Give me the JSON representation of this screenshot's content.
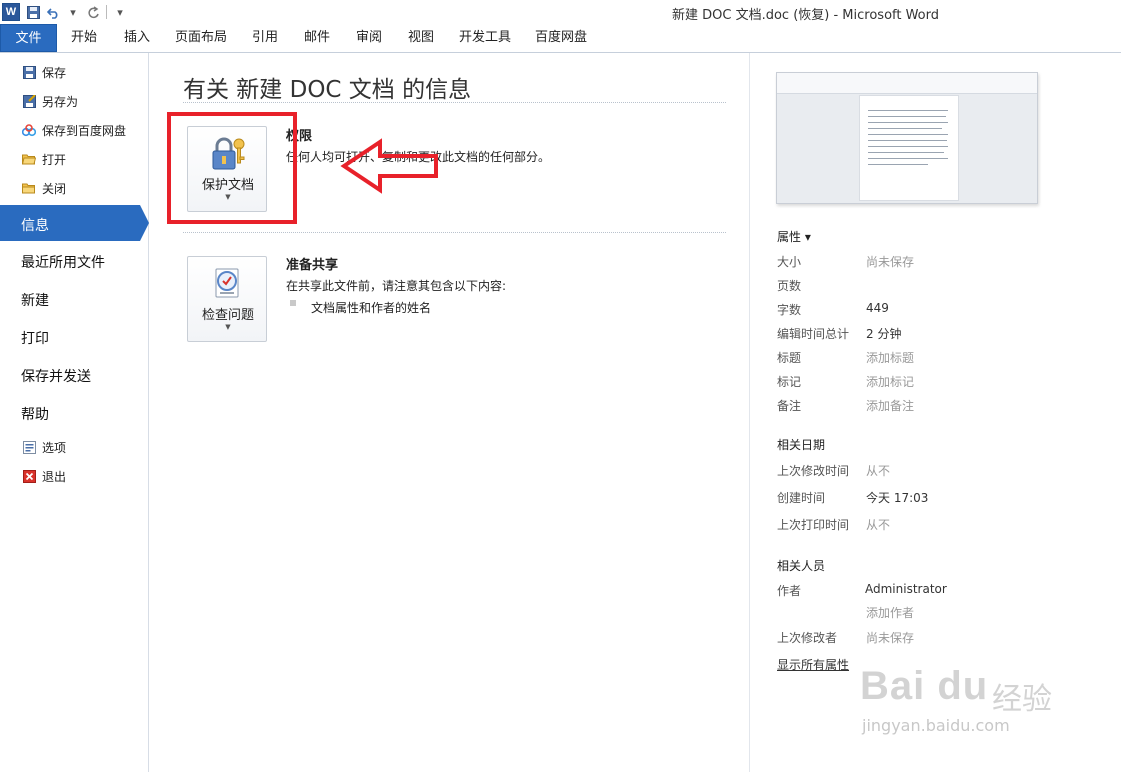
{
  "window": {
    "title": "新建 DOC 文档.doc (恢复)  -  Microsoft Word",
    "app_icon": "word-logo",
    "logo_letter": "W"
  },
  "quick_access": [
    "save-icon",
    "undo-icon",
    "redo-icon"
  ],
  "ribbon_tabs": [
    "文件",
    "开始",
    "插入",
    "页面布局",
    "引用",
    "邮件",
    "审阅",
    "视图",
    "开发工具",
    "百度网盘"
  ],
  "sidebar": {
    "items": [
      {
        "label": "保存",
        "icon": "save-icon"
      },
      {
        "label": "另存为",
        "icon": "save-as-icon"
      },
      {
        "label": "保存到百度网盘",
        "icon": "baidu-cloud-icon"
      },
      {
        "label": "打开",
        "icon": "open-folder-icon"
      },
      {
        "label": "关闭",
        "icon": "close-folder-icon"
      }
    ],
    "active": "信息",
    "sections": [
      "最近所用文件",
      "新建",
      "打印",
      "保存并发送",
      "帮助"
    ],
    "bottom": [
      {
        "label": "选项",
        "icon": "options-icon"
      },
      {
        "label": "退出",
        "icon": "exit-icon"
      }
    ]
  },
  "main": {
    "title": "有关 新建 DOC 文档 的信息",
    "permissions": {
      "button": "保护文档",
      "title": "权限",
      "desc": "任何人均可打开、复制和更改此文档的任何部分。",
      "icon": "lock-key-icon"
    },
    "share": {
      "button": "检查问题",
      "title": "准备共享",
      "desc": "在共享此文件前，请注意其包含以下内容:",
      "bullets": [
        "文档属性和作者的姓名"
      ],
      "icon": "check-document-icon"
    }
  },
  "properties": {
    "header": "属性 ▾",
    "rows": [
      {
        "k": "大小",
        "v": "尚未保存",
        "muted": true
      },
      {
        "k": "页数",
        "v": "",
        "muted": false
      },
      {
        "k": "字数",
        "v": "449",
        "muted": false
      },
      {
        "k": "编辑时间总计",
        "v": "2 分钟",
        "muted": false
      },
      {
        "k": "标题",
        "v": "添加标题",
        "muted": true
      },
      {
        "k": "标记",
        "v": "添加标记",
        "muted": true
      },
      {
        "k": "备注",
        "v": "添加备注",
        "muted": true
      }
    ],
    "dates_header": "相关日期",
    "dates": [
      {
        "k": "上次修改时间",
        "v": "从不",
        "muted": true
      },
      {
        "k": "创建时间",
        "v": "今天 17:03",
        "muted": false
      },
      {
        "k": "上次打印时间",
        "v": "从不",
        "muted": true
      }
    ],
    "people_header": "相关人员",
    "author_k": "作者",
    "author_v": "Administrator",
    "add_author": "添加作者",
    "last_mod_k": "上次修改者",
    "last_mod_v": "尚未保存",
    "show_all": "显示所有属性"
  },
  "watermark": {
    "brand": "Bai du",
    "cn": "经验",
    "url": "jingyan.baidu.com"
  },
  "colors": {
    "accent": "#2a6bbf",
    "annotation": "#e8212a"
  }
}
